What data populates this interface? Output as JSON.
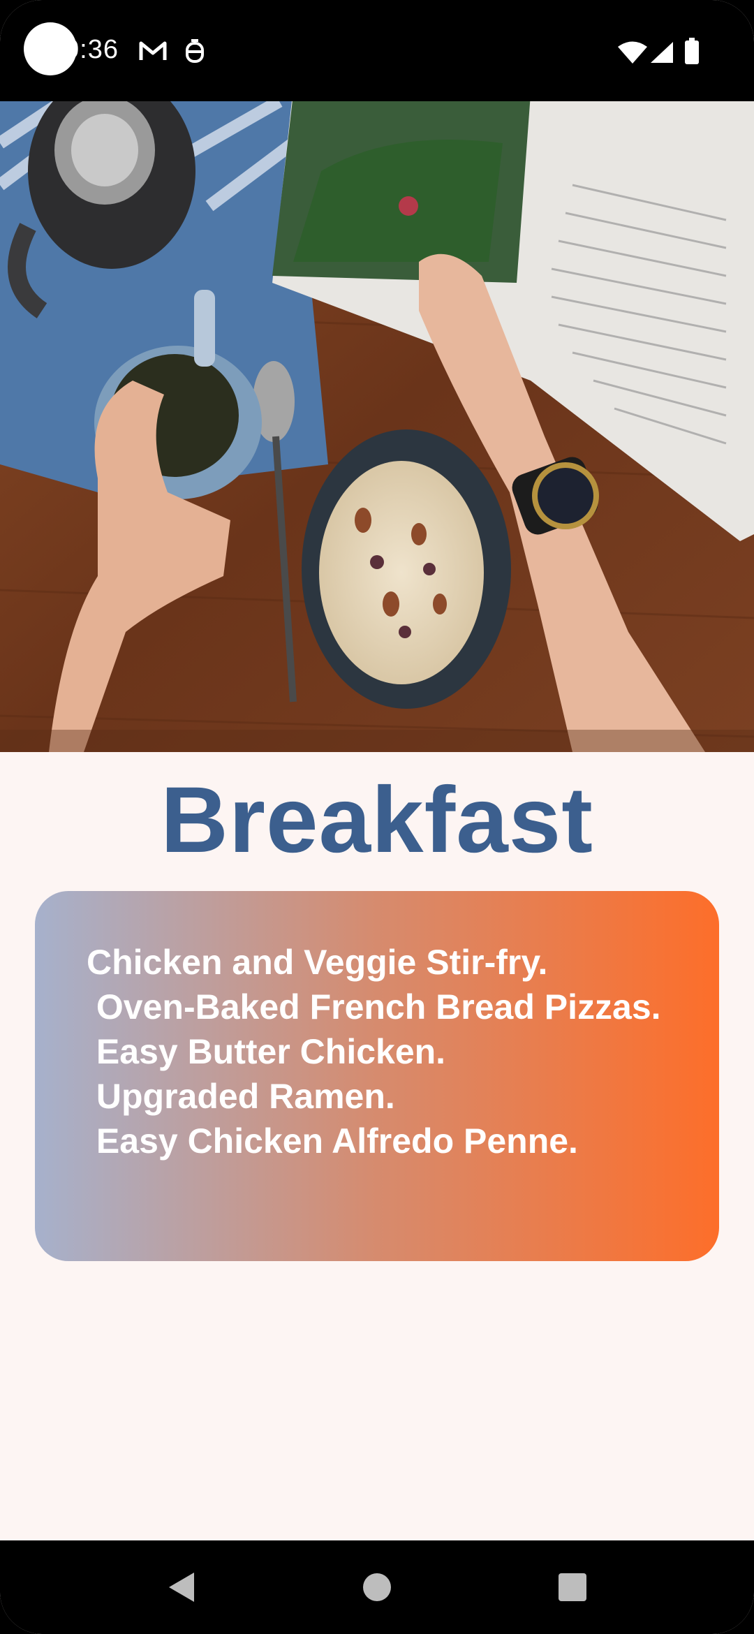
{
  "status_bar": {
    "time": "0:36",
    "icons": [
      "mail-icon",
      "notification-icon",
      "wifi-icon",
      "signal-icon",
      "battery-icon"
    ]
  },
  "hero": {
    "image_subject": "breakfast table with tea, cereal bowl and open magazine"
  },
  "title": "Breakfast",
  "menu_items": [
    "Chicken and Veggie Stir-fry.",
    " Oven-Baked French Bread Pizzas.",
    " Easy Butter Chicken.",
    " Upgraded Ramen.",
    " Easy Chicken Alfredo Penne."
  ],
  "colors": {
    "title": "#3c5f8e",
    "background": "#fdf5f3",
    "card_gradient_start": "#a6b1cc",
    "card_gradient_end": "#fd6e2a"
  },
  "nav_bar": {
    "icons": [
      "back-icon",
      "home-icon",
      "recents-icon"
    ]
  }
}
